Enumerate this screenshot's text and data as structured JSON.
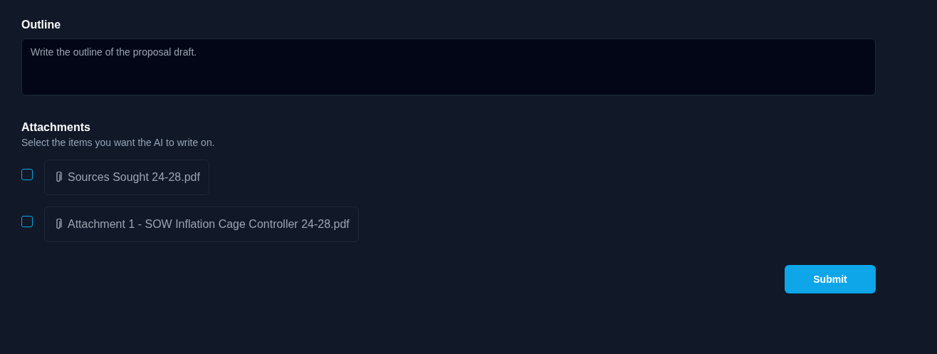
{
  "outline": {
    "label": "Outline",
    "placeholder": "Write the outline of the proposal draft."
  },
  "attachments": {
    "title": "Attachments",
    "description": "Select the items you want the AI to write on.",
    "items": [
      {
        "name": "Sources Sought 24-28.pdf",
        "checked": false
      },
      {
        "name": "Attachment 1 - SOW Inflation Cage Controller 24-28.pdf",
        "checked": false
      }
    ]
  },
  "submit": "Submit"
}
